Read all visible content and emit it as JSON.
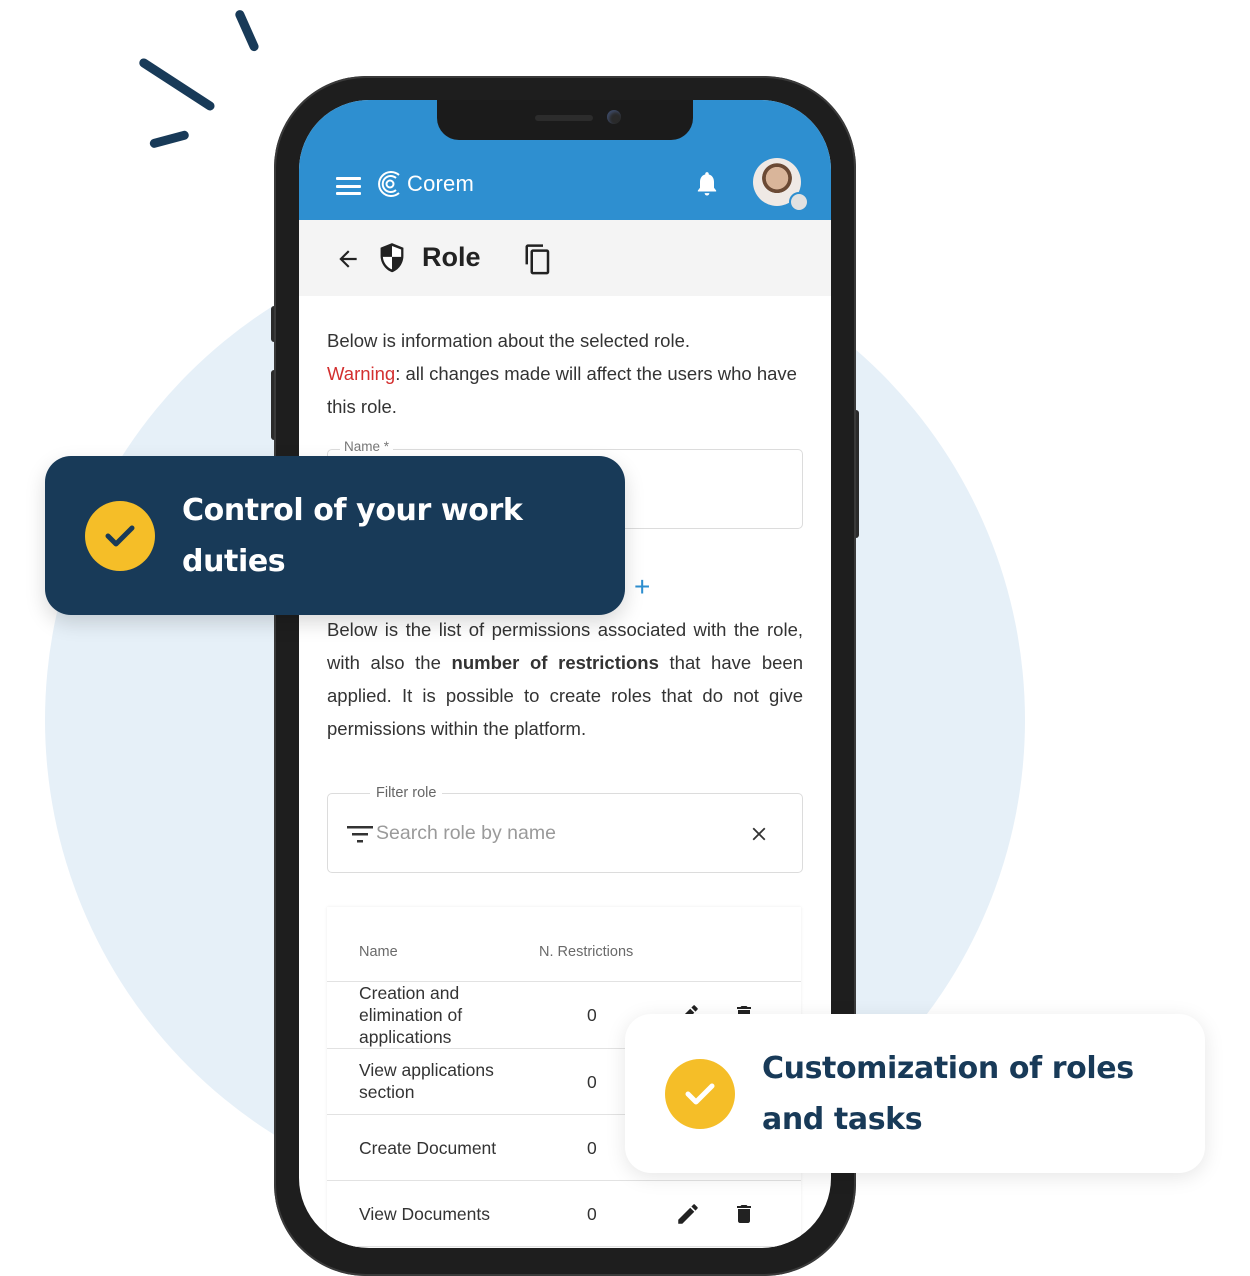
{
  "app": {
    "brand": "Corem",
    "colors": {
      "appbar": "#2e8fd0",
      "accent_card": "#183a58",
      "check": "#f5be28",
      "warning": "#d32f2f"
    }
  },
  "header": {
    "menu_icon": "hamburger-menu-icon",
    "logo_icon": "corem-logo-icon",
    "notification_icon": "bell-icon",
    "avatar": "user-avatar"
  },
  "toolbar": {
    "back_icon": "arrow-left-icon",
    "title_icon": "shield-icon",
    "title": "Role",
    "copy_icon": "copy-icon"
  },
  "content": {
    "intro": "Below is information about the selected role.",
    "warning_label": "Warning",
    "warning_text": ": all changes made will affect the users who have this role.",
    "name_field": {
      "label": "Name *",
      "value": ""
    },
    "add_icon": "plus-icon",
    "permissions_intro_1": "Below is the list of permissions associated with the role, with also the ",
    "permissions_intro_bold": "number of restrictions",
    "permissions_intro_2": " that have been applied. It is possible to create roles that do not give permissions within the platform.",
    "filter": {
      "label": "Filter role",
      "placeholder": "Search role by name",
      "value": "",
      "filter_icon": "filter-icon",
      "clear_icon": "close-icon"
    },
    "table": {
      "columns": [
        "Name",
        "N. Restrictions"
      ],
      "rows": [
        {
          "name": "Creation and elimination of applications",
          "restrictions": "0"
        },
        {
          "name": "View applications section",
          "restrictions": "0"
        },
        {
          "name": "Create Document",
          "restrictions": "0"
        },
        {
          "name": "View Documents",
          "restrictions": "0"
        }
      ],
      "row_actions": [
        "pencil-icon",
        "trash-icon"
      ]
    }
  },
  "features": [
    {
      "text": "Control of your work duties",
      "icon": "check-circle-icon"
    },
    {
      "text": "Customization of roles and tasks",
      "icon": "check-circle-icon"
    }
  ]
}
